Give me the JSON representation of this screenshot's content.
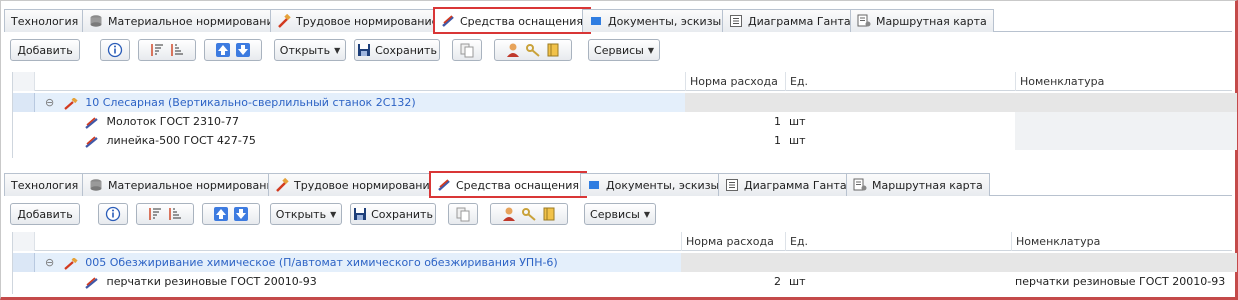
{
  "tabs": [
    {
      "label": "Технология",
      "icon": "none"
    },
    {
      "label": "Материальное нормирование",
      "icon": "database-icon"
    },
    {
      "label": "Трудовое нормирование",
      "icon": "hammer-icon"
    },
    {
      "label": "Средства оснащения",
      "icon": "tools-icon",
      "active": true
    },
    {
      "label": "Документы, эскизы",
      "icon": "document-icon"
    },
    {
      "label": "Диаграмма Ганта",
      "icon": "gantt-icon"
    },
    {
      "label": "Маршрутная карта",
      "icon": "route-card-icon"
    }
  ],
  "toolbar": {
    "add_label": "Добавить",
    "open_label": "Открыть",
    "save_label": "Сохранить",
    "services_label": "Сервисы"
  },
  "columns": {
    "rate": "Норма расхода",
    "unit": "Ед.",
    "nomenclature": "Номенклатура"
  },
  "panel1": {
    "operation": "10 Слесарная (Вертикально-сверлильный станок 2С132)",
    "rows": [
      {
        "name": "Молоток ГОСТ 2310-77",
        "rate": "1",
        "unit": "шт",
        "nomenclature": ""
      },
      {
        "name": "линейка-500  ГОСТ 427-75",
        "rate": "1",
        "unit": "шт",
        "nomenclature": ""
      }
    ]
  },
  "panel2": {
    "operation": "005 Обезжиривание химическое (П/автомат химического обезжиривания УПН-6)",
    "rows": [
      {
        "name": "перчатки резиновые  ГОСТ 20010-93",
        "rate": "2",
        "unit": "шт",
        "nomenclature": "перчатки резиновые  ГОСТ 20010-93"
      }
    ]
  },
  "colors": {
    "highlight": "#d93636",
    "link_blue": "#2d63c5",
    "selected_row": "#e4effb"
  }
}
